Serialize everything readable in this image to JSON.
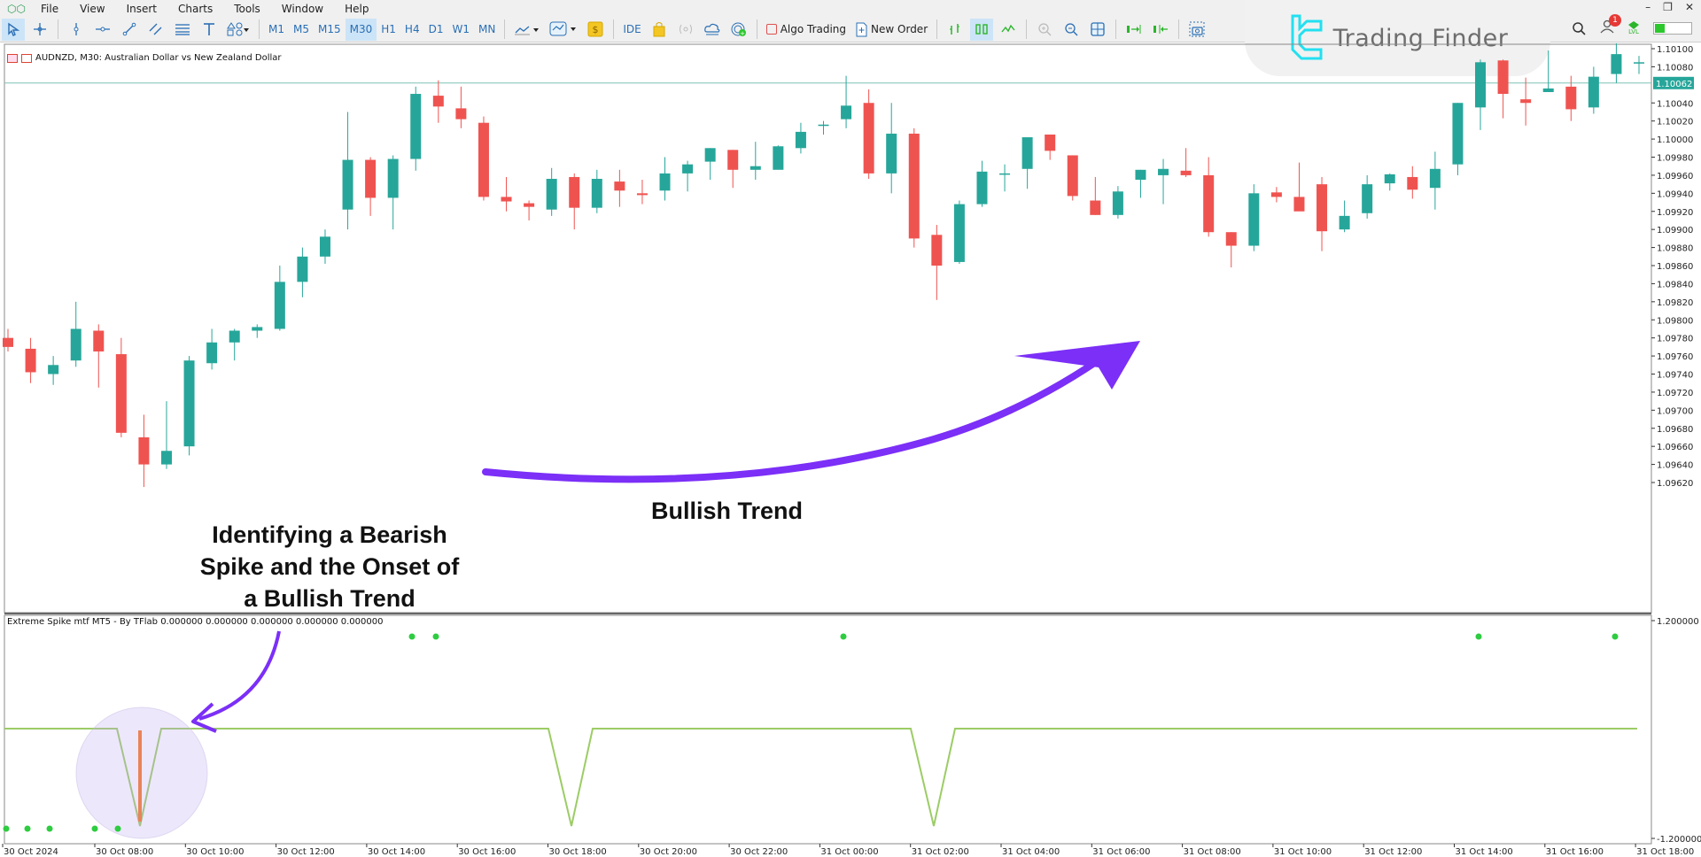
{
  "menu": {
    "items": [
      "File",
      "View",
      "Insert",
      "Charts",
      "Tools",
      "Window",
      "Help"
    ]
  },
  "toolbar": {
    "timeframes": [
      "M1",
      "M5",
      "M15",
      "M30",
      "H1",
      "H4",
      "D1",
      "W1",
      "MN"
    ],
    "active_timeframe": "M30",
    "ide_label": "IDE",
    "algo_trading_label": "Algo Trading",
    "new_order_label": "New Order",
    "notification_count": "1",
    "lvl_label": "LVL",
    "lvl_progress": 0.25
  },
  "logo": {
    "text": "Trading Finder"
  },
  "chart": {
    "title": "AUDNZD, M30:  Australian Dollar vs New Zealand Dollar",
    "current_price_label": "1.10062",
    "indicator_title": "Extreme Spike mtf MT5 - By TFlab 0.000000 0.000000 0.000000 0.000000 0.000000"
  },
  "annotations": {
    "spike_text": "Identifying a Bearish Spike and the Onset of a Bullish Trend",
    "trend_text": "Bullish Trend"
  },
  "colors": {
    "bull": "#26a69a",
    "bear": "#ef5350",
    "indicator_line": "#9ccc65",
    "dot": "#2ecc40",
    "arrow": "#7b2ff7",
    "spike_bar": "#e8845a",
    "price_line": "#7fc4b5"
  },
  "chart_data": {
    "type": "candlestick",
    "symbol": "AUDNZD",
    "timeframe": "M30",
    "ylim": [
      1.0961,
      1.1011
    ],
    "yticks": [
      "1.10100",
      "1.10080",
      "1.10062",
      "1.10040",
      "1.10020",
      "1.10000",
      "1.09980",
      "1.09960",
      "1.09940",
      "1.09920",
      "1.09900",
      "1.09880",
      "1.09860",
      "1.09840",
      "1.09820",
      "1.09800",
      "1.09780",
      "1.09760",
      "1.09740",
      "1.09720",
      "1.09700",
      "1.09680",
      "1.09660",
      "1.09640",
      "1.09620"
    ],
    "xticks": [
      "30 Oct 2024",
      "30 Oct 08:00",
      "30 Oct 10:00",
      "30 Oct 12:00",
      "30 Oct 14:00",
      "30 Oct 16:00",
      "30 Oct 18:00",
      "30 Oct 20:00",
      "30 Oct 22:00",
      "31 Oct 00:00",
      "31 Oct 02:00",
      "31 Oct 04:00",
      "31 Oct 06:00",
      "31 Oct 08:00",
      "31 Oct 10:00",
      "31 Oct 12:00",
      "31 Oct 14:00",
      "31 Oct 16:00",
      "31 Oct 18:00"
    ],
    "current_price": 1.10062,
    "candles": [
      [
        1.0978,
        1.0979,
        1.09765,
        1.0977
      ],
      [
        1.09768,
        1.0978,
        1.0973,
        1.09742
      ],
      [
        1.0974,
        1.0976,
        1.09728,
        1.0975
      ],
      [
        1.09755,
        1.0982,
        1.09748,
        1.0979
      ],
      [
        1.09788,
        1.09795,
        1.09725,
        1.09765
      ],
      [
        1.09762,
        1.0978,
        1.0967,
        1.09675
      ],
      [
        1.0967,
        1.09695,
        1.09615,
        1.0964
      ],
      [
        1.0964,
        1.0971,
        1.09635,
        1.09655
      ],
      [
        1.0966,
        1.0976,
        1.0965,
        1.09755
      ],
      [
        1.09752,
        1.0979,
        1.09745,
        1.09775
      ],
      [
        1.09775,
        1.0979,
        1.09755,
        1.09788
      ],
      [
        1.09788,
        1.09795,
        1.0978,
        1.09792
      ],
      [
        1.0979,
        1.0986,
        1.09788,
        1.09842
      ],
      [
        1.09842,
        1.0988,
        1.09825,
        1.0987
      ],
      [
        1.0987,
        1.099,
        1.09862,
        1.09892
      ],
      [
        1.09922,
        1.1003,
        1.099,
        1.09977
      ],
      [
        1.09977,
        1.0998,
        1.09915,
        1.09935
      ],
      [
        1.09935,
        1.09982,
        1.099,
        1.09978
      ],
      [
        1.09978,
        1.10058,
        1.09965,
        1.1005
      ],
      [
        1.10048,
        1.10065,
        1.10018,
        1.10036
      ],
      [
        1.10034,
        1.10058,
        1.10012,
        1.10022
      ],
      [
        1.10018,
        1.10025,
        1.09932,
        1.09936
      ],
      [
        1.09936,
        1.09958,
        1.0992,
        1.09931
      ],
      [
        1.09929,
        1.09932,
        1.0991,
        1.09925
      ],
      [
        1.09922,
        1.09968,
        1.09915,
        1.09956
      ],
      [
        1.09958,
        1.09962,
        1.099,
        1.09924
      ],
      [
        1.09924,
        1.09966,
        1.09918,
        1.09956
      ],
      [
        1.09953,
        1.09966,
        1.09925,
        1.09943
      ],
      [
        1.0994,
        1.09955,
        1.09928,
        1.09938
      ],
      [
        1.09943,
        1.0998,
        1.09932,
        1.09962
      ],
      [
        1.09962,
        1.09976,
        1.09942,
        1.09972
      ],
      [
        1.09975,
        1.0999,
        1.09955,
        1.0999
      ],
      [
        1.09988,
        1.09988,
        1.09946,
        1.09966
      ],
      [
        1.09966,
        1.09997,
        1.09955,
        1.0997
      ],
      [
        1.09966,
        1.09993,
        1.09968,
        1.09992
      ],
      [
        1.0999,
        1.10018,
        1.09984,
        1.10008
      ],
      [
        1.10016,
        1.1002,
        1.10005,
        1.10016
      ],
      [
        1.10022,
        1.1007,
        1.10012,
        1.10037
      ],
      [
        1.1004,
        1.10055,
        1.09956,
        1.09962
      ],
      [
        1.09962,
        1.1004,
        1.0994,
        1.10006
      ],
      [
        1.10006,
        1.10012,
        1.0988,
        1.0989
      ],
      [
        1.09894,
        1.09905,
        1.09822,
        1.0986
      ],
      [
        1.09864,
        1.09932,
        1.09862,
        1.09928
      ],
      [
        1.09928,
        1.09976,
        1.09925,
        1.09964
      ],
      [
        1.09962,
        1.09972,
        1.09942,
        1.09962
      ],
      [
        1.09967,
        1.09996,
        1.09945,
        1.10002
      ],
      [
        1.10005,
        1.10005,
        1.09977,
        1.09987
      ],
      [
        1.09982,
        1.09982,
        1.09932,
        1.09937
      ],
      [
        1.09932,
        1.09958,
        1.09916,
        1.09916
      ],
      [
        1.09916,
        1.09948,
        1.09912,
        1.09942
      ],
      [
        1.09955,
        1.09966,
        1.09935,
        1.09966
      ],
      [
        1.0996,
        1.09978,
        1.09928,
        1.09967
      ],
      [
        1.09965,
        1.0999,
        1.09958,
        1.0996
      ],
      [
        1.0996,
        1.0998,
        1.09892,
        1.09897
      ],
      [
        1.09897,
        1.09897,
        1.09858,
        1.09882
      ],
      [
        1.09882,
        1.0995,
        1.09876,
        1.0994
      ],
      [
        1.09941,
        1.09947,
        1.0993,
        1.09936
      ],
      [
        1.09936,
        1.09974,
        1.09926,
        1.0992
      ],
      [
        1.0995,
        1.09958,
        1.09876,
        1.09898
      ],
      [
        1.099,
        1.09932,
        1.09897,
        1.09915
      ],
      [
        1.09918,
        1.0996,
        1.09912,
        1.0995
      ],
      [
        1.09951,
        1.09962,
        1.09943,
        1.09961
      ],
      [
        1.09958,
        1.0997,
        1.09934,
        1.09944
      ],
      [
        1.09946,
        1.09986,
        1.09922,
        1.09967
      ],
      [
        1.09972,
        1.1004,
        1.0996,
        1.1004
      ],
      [
        1.10035,
        1.10088,
        1.1001,
        1.10085
      ],
      [
        1.10087,
        1.10088,
        1.10023,
        1.1005
      ],
      [
        1.10044,
        1.10068,
        1.10015,
        1.1004
      ],
      [
        1.10052,
        1.10098,
        1.10055,
        1.10056
      ],
      [
        1.10058,
        1.1007,
        1.1002,
        1.10033
      ],
      [
        1.10035,
        1.1008,
        1.10028,
        1.10069
      ],
      [
        1.10072,
        1.10106,
        1.10062,
        1.10094
      ],
      [
        1.10085,
        1.10092,
        1.10072,
        1.10085
      ]
    ],
    "indicator": {
      "name": "Extreme Spike mtf MT5 - By TFlab",
      "ylim": [
        -1.2,
        1.2
      ],
      "yticks": [
        "1.200000",
        "-1.200000"
      ],
      "baseline": 0.0,
      "spike_dips_at_candles": [
        6,
        25,
        41
      ],
      "spike_dip_level": -1.0,
      "dots_top_candles": [
        18,
        19,
        37,
        66,
        72
      ],
      "dots_bottom_candles": [
        0,
        1,
        2,
        4,
        5
      ],
      "highlighted_bearish_spike_candle": 6
    }
  }
}
